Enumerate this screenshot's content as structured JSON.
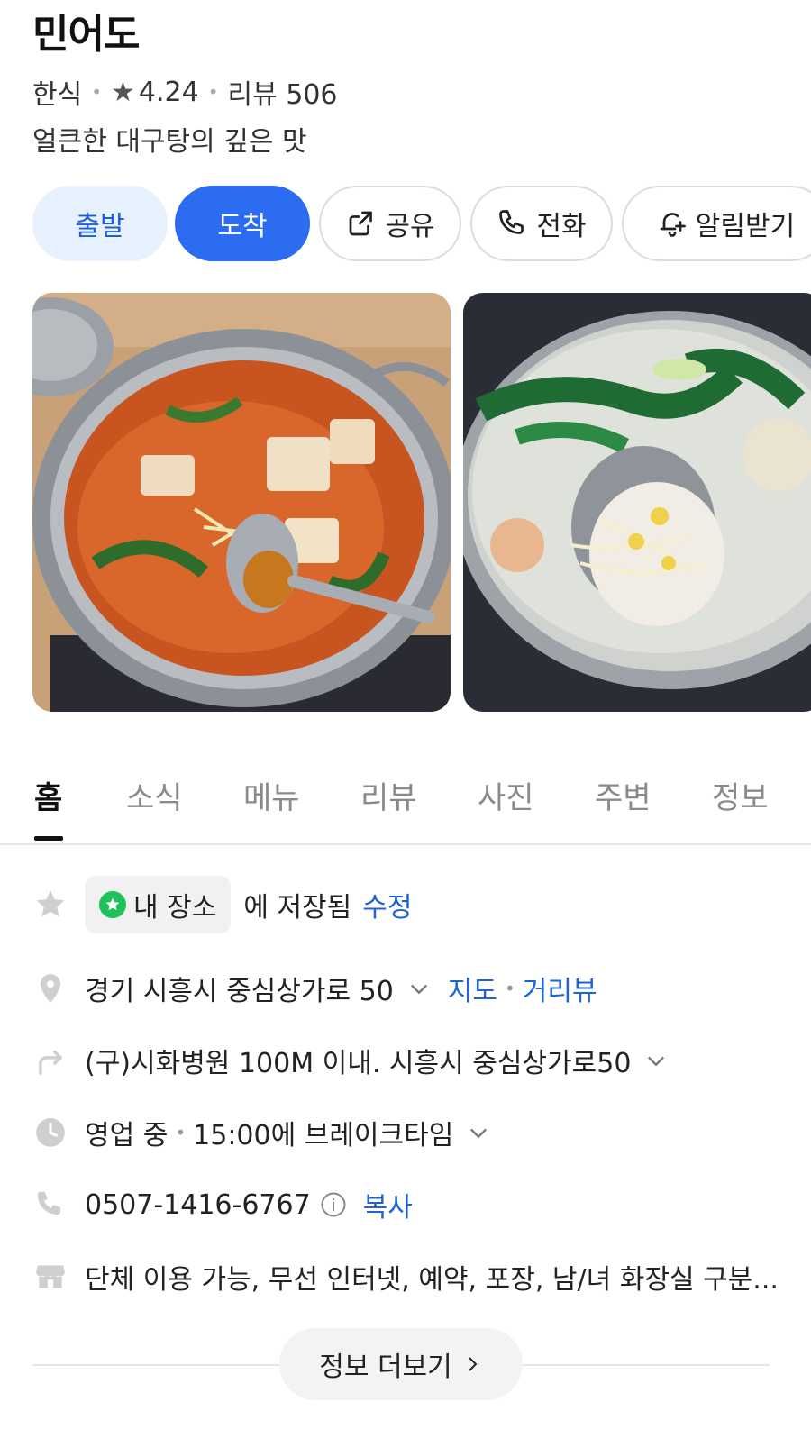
{
  "place": {
    "name": "민어도",
    "category": "한식",
    "rating": "4.24",
    "review_label": "리뷰 506",
    "description": "얼큰한 대구탕의 깊은 맛"
  },
  "actions": {
    "depart": "출발",
    "arrive": "도착",
    "share": "공유",
    "call": "전화",
    "alert": "알림받기"
  },
  "tabs": [
    "홈",
    "소식",
    "메뉴",
    "리뷰",
    "사진",
    "주변",
    "정보"
  ],
  "info": {
    "saved_chip": "내 장소",
    "saved_text": "에 저장됨",
    "saved_edit": "수정",
    "address": "경기 시흥시 중심상가로 50",
    "map_link": "지도",
    "roadview_link": "거리뷰",
    "directions": "(구)시화병원 100M 이내. 시흥시 중심상가로50",
    "status": "영업 중",
    "status_detail": "15:00에 브레이크타임",
    "phone": "0507-1416-6767",
    "copy": "복사",
    "facilities": "단체 이용 가능, 무선 인터넷, 예약, 포장, 남/녀 화장실 구분..."
  },
  "more_button": "정보 더보기",
  "colors": {
    "accent": "#2b6cf0",
    "link": "#1f63d6",
    "saved_green": "#1ec15a"
  }
}
